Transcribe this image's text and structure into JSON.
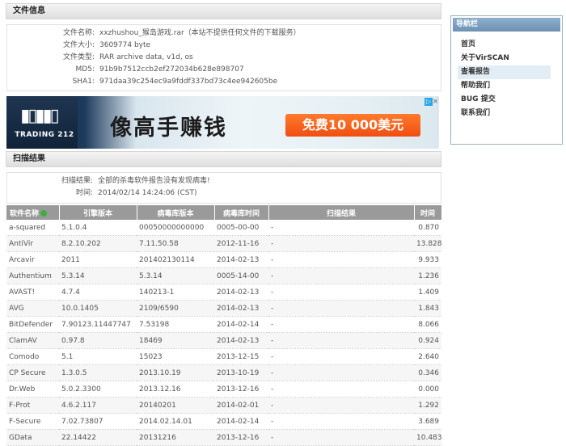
{
  "file_info": {
    "title": "文件信息",
    "rows": [
      {
        "label": "文件名称:",
        "value": "xxzhushou_猴岛游戏.rar（本站不提供任何文件的下载服务）"
      },
      {
        "label": "文件大小:",
        "value": "3609774 byte"
      },
      {
        "label": "文件类型:",
        "value": "RAR archive data, v1d, os"
      },
      {
        "label": "MD5:",
        "value": "91b9b7512ccb2ef272034b628e898707"
      },
      {
        "label": "SHA1:",
        "value": "971daa39c254ec9a9fddf337bd73c4ee942605be"
      }
    ]
  },
  "banner": {
    "brand": "TRADING 212",
    "slogan": "像高手赚钱",
    "cta": "免费10 000美元",
    "adchoice": "▷",
    "close": "×"
  },
  "scan": {
    "title": "扫描结果",
    "summary": [
      {
        "label": "扫描结果:",
        "value": "全部的杀毒软件报告没有发现病毒!"
      },
      {
        "label": "时间:",
        "value": "2014/02/14 14:24:06 (CST)"
      }
    ],
    "columns": [
      "软件名称",
      "引擎版本",
      "病毒库版本",
      "病毒库时间",
      "扫描结果",
      "时间"
    ],
    "rows": [
      [
        "a-squared",
        "5.1.0.4",
        "00050000000000",
        "0005-00-00",
        "-",
        "0.870"
      ],
      [
        "AntiVir",
        "8.2.10.202",
        "7.11.50.58",
        "2012-11-16",
        "-",
        "13.828"
      ],
      [
        "Arcavir",
        "2011",
        "201402130114",
        "2014-02-13",
        "-",
        "9.933"
      ],
      [
        "Authentium",
        "5.3.14",
        "5.3.14",
        "0005-14-00",
        "-",
        "1.236"
      ],
      [
        "AVAST!",
        "4.7.4",
        "140213-1",
        "2014-02-13",
        "-",
        "1.409"
      ],
      [
        "AVG",
        "10.0.1405",
        "2109/6590",
        "2014-02-13",
        "-",
        "1.843"
      ],
      [
        "BitDefender",
        "7.90123.11447747",
        "7.53198",
        "2014-02-14",
        "-",
        "8.066"
      ],
      [
        "ClamAV",
        "0.97.8",
        "18469",
        "2014-02-13",
        "-",
        "0.924"
      ],
      [
        "Comodo",
        "5.1",
        "15023",
        "2013-12-15",
        "-",
        "2.640"
      ],
      [
        "CP Secure",
        "1.3.0.5",
        "2013.10.19",
        "2013-10-19",
        "-",
        "0.346"
      ],
      [
        "Dr.Web",
        "5.0.2.3300",
        "2013.12.16",
        "2013-12-16",
        "-",
        "0.000"
      ],
      [
        "F-Prot",
        "4.6.2.117",
        "20140201",
        "2014-02-01",
        "-",
        "1.292"
      ],
      [
        "F-Secure",
        "7.02.73807",
        "2014.02.14.01",
        "2014-02-14",
        "-",
        "3.689"
      ],
      [
        "GData",
        "22.14422",
        "20131216",
        "2013-12-16",
        "-",
        "10.483"
      ]
    ]
  },
  "sidebar": {
    "title": "导航栏",
    "items": [
      "首页",
      "关于VirSCAN",
      "查看报告",
      "帮助我们",
      "BUG 提交",
      "联系我们"
    ]
  }
}
